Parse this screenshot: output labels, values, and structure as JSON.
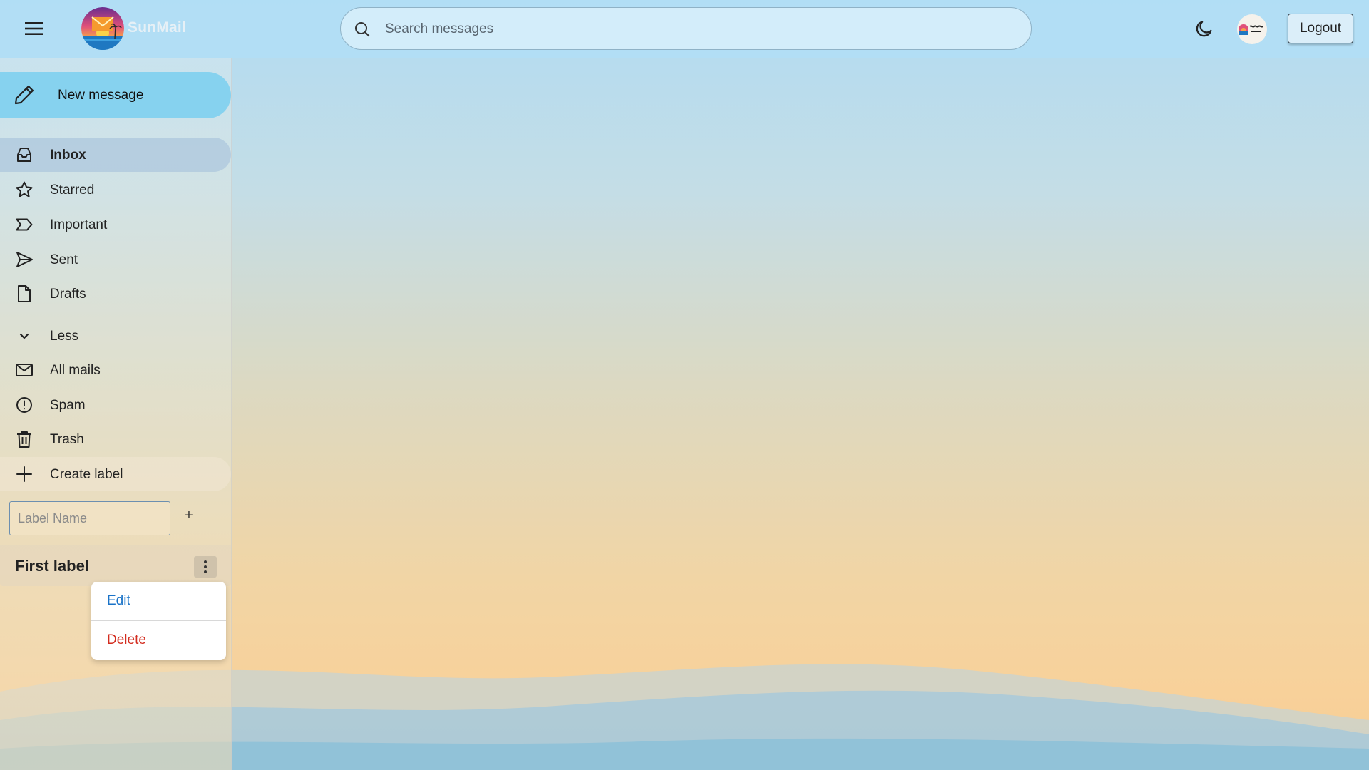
{
  "app": {
    "name": "SunMail"
  },
  "header": {
    "search_placeholder": "Search messages",
    "logout_label": "Logout"
  },
  "sidebar": {
    "compose_label": "New message",
    "items": [
      {
        "label": "Inbox",
        "icon": "inbox-icon",
        "active": true
      },
      {
        "label": "Starred",
        "icon": "star-icon"
      },
      {
        "label": "Important",
        "icon": "important-icon"
      },
      {
        "label": "Sent",
        "icon": "send-icon"
      },
      {
        "label": "Drafts",
        "icon": "file-icon"
      }
    ],
    "toggle_label": "Less",
    "more_items": [
      {
        "label": "All mails",
        "icon": "mail-icon"
      },
      {
        "label": "Spam",
        "icon": "alert-circle-icon"
      },
      {
        "label": "Trash",
        "icon": "trash-icon"
      }
    ],
    "create_label": "Create label",
    "label_input_placeholder": "Label Name",
    "add_label_button": "+",
    "labels": [
      {
        "name": "First label"
      }
    ]
  },
  "label_menu": {
    "edit_label": "Edit",
    "delete_label": "Delete",
    "edit_color": "#1a73c8",
    "delete_color": "#d32c1f"
  },
  "colors": {
    "header_bg": "#b2def6",
    "compose_bg": "#86d2ef",
    "active_item_bg": "#b4c8dc"
  }
}
